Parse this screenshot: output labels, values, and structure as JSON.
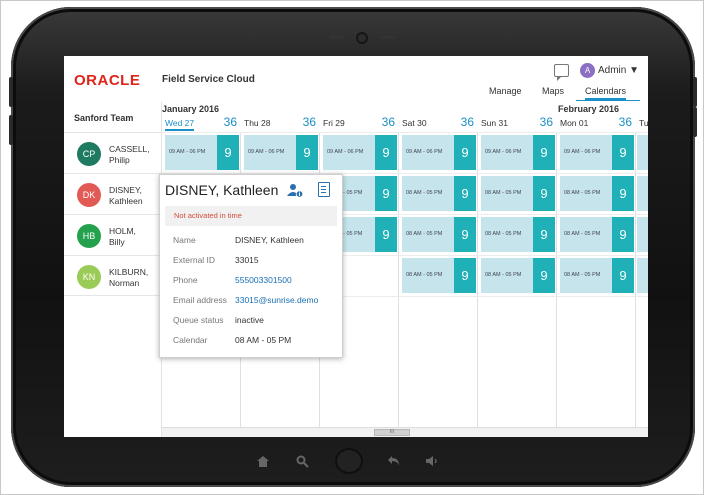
{
  "header": {
    "logo": "ORACLE",
    "product": "Field Service Cloud",
    "user_initial": "A",
    "user_name": "Admin ▼",
    "nav": [
      "Manage",
      "Maps",
      "Calendars"
    ]
  },
  "team": {
    "title": "Sanford Team",
    "members": [
      {
        "initials": "CP",
        "line1": "CASSELL,",
        "line2": "Philip",
        "color": "#1e7a60"
      },
      {
        "initials": "DK",
        "line1": "DISNEY,",
        "line2": "Kathleen",
        "color": "#e25a55"
      },
      {
        "initials": "HB",
        "line1": "HOLM,",
        "line2": "Billy",
        "color": "#24a14d"
      },
      {
        "initials": "KN",
        "line1": "KILBURN,",
        "line2": "Norman",
        "color": "#9bcb57"
      }
    ]
  },
  "calendar": {
    "months": [
      "January 2016",
      "February 2016"
    ],
    "days": [
      {
        "label": "Wed 27",
        "count": "36"
      },
      {
        "label": "Thu 28",
        "count": "36"
      },
      {
        "label": "Fri 29",
        "count": "36"
      },
      {
        "label": "Sat 30",
        "count": "36"
      },
      {
        "label": "Sun 31",
        "count": "36"
      },
      {
        "label": "Mon 01",
        "count": "36"
      },
      {
        "label": "Tu",
        "count": ""
      }
    ],
    "slot_time_a": "09 AM - 06 PM",
    "slot_time_b": "08 AM - 05 PM",
    "slot_count": "9",
    "scroll_thumb": "III"
  },
  "popup": {
    "name": "DISNEY, Kathleen",
    "warning": "Not activated in time",
    "fields": [
      {
        "label": "Name",
        "value": "DISNEY, Kathleen",
        "link": false
      },
      {
        "label": "External ID",
        "value": "33015",
        "link": false
      },
      {
        "label": "Phone",
        "value": "555003301500",
        "link": true
      },
      {
        "label": "Email address",
        "value": "33015@sunrise.demo",
        "link": true
      },
      {
        "label": "Queue status",
        "value": "inactive",
        "link": false
      },
      {
        "label": "Calendar",
        "value": "08 AM - 05 PM",
        "link": false
      }
    ]
  }
}
